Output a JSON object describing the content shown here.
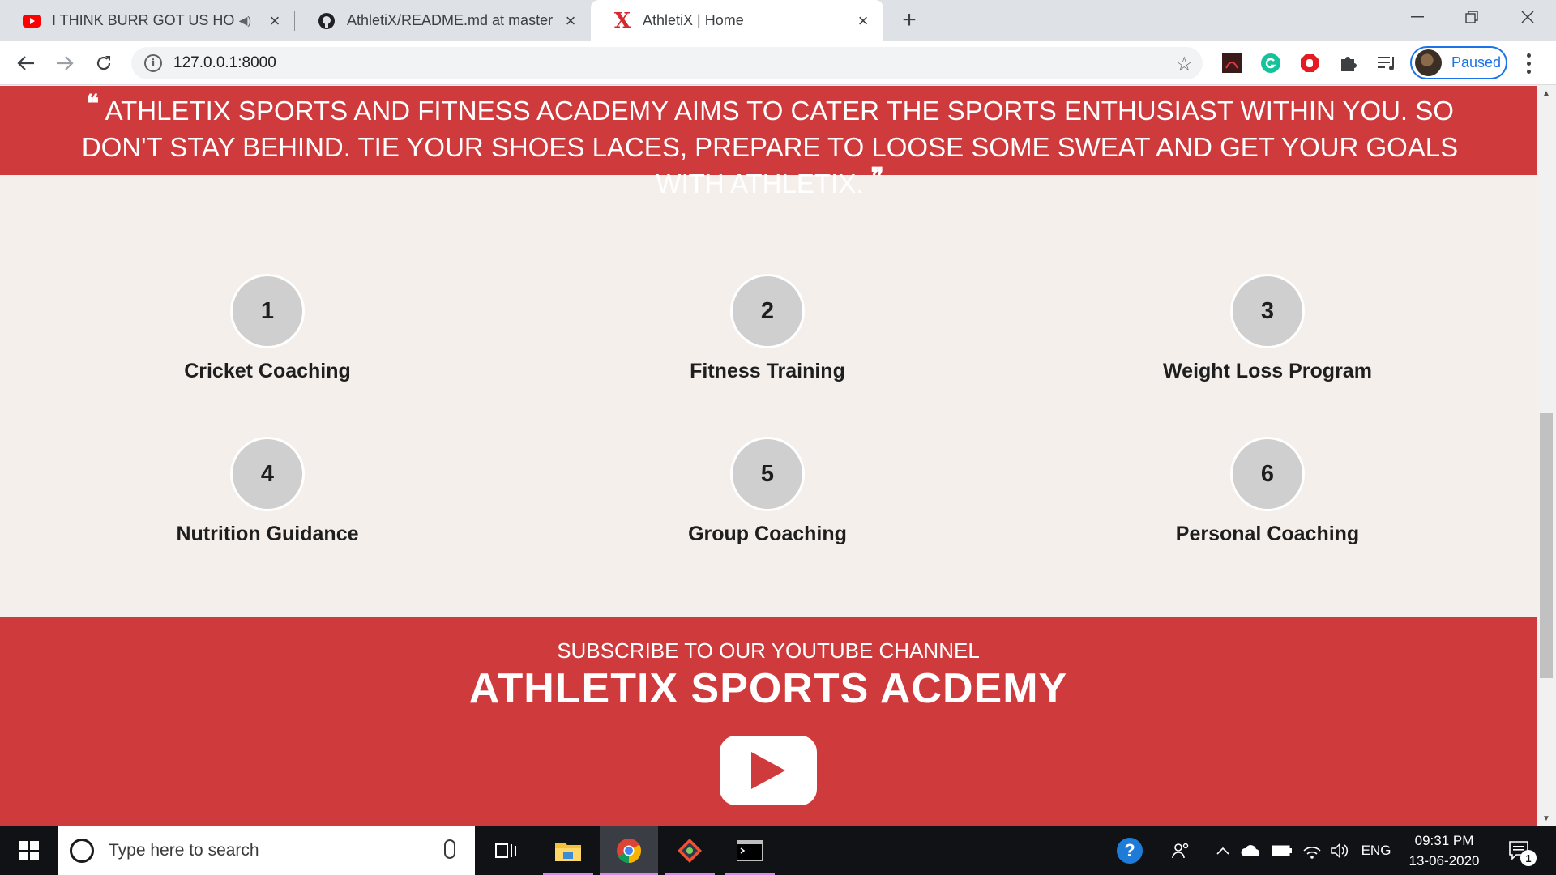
{
  "browser": {
    "tabs": [
      {
        "title": "I THINK BURR GOT US HOOK",
        "favicon": "youtube-icon",
        "audio": true,
        "active": false
      },
      {
        "title": "AthletiX/README.md at master",
        "favicon": "github-icon",
        "audio": false,
        "active": false
      },
      {
        "title": "AthletiX | Home",
        "favicon": "athletix-x-icon",
        "audio": false,
        "active": true
      }
    ],
    "new_tab_label": "+",
    "address": "127.0.0.1:8000",
    "profile_status": "Paused",
    "extensions": [
      "pdf-icon",
      "grammarly-icon",
      "adblock-icon",
      "puzzle-icon",
      "media-queue-icon"
    ]
  },
  "page": {
    "quote": "Athletix Sports and Fitness Academy aims to cater the sports enthusiast within you. So don't stay behind. Tie your shoes laces, prepare to loose some sweat and get your goals with Athletix.",
    "services": [
      {
        "number": "1",
        "label": "Cricket Coaching"
      },
      {
        "number": "2",
        "label": "Fitness Training"
      },
      {
        "number": "3",
        "label": "Weight Loss Program"
      },
      {
        "number": "4",
        "label": "Nutrition Guidance"
      },
      {
        "number": "5",
        "label": "Group Coaching"
      },
      {
        "number": "6",
        "label": "Personal Coaching"
      }
    ],
    "subscribe": {
      "title": "Subscribe to our YouTube Channel",
      "channel": "Athletix Sports Acdemy",
      "button_icon": "youtube-play-icon"
    },
    "colors": {
      "accent": "#cf3a3d",
      "background": "#f5efeb",
      "circle": "#cfcfcf"
    }
  },
  "taskbar": {
    "search_placeholder": "Type here to search",
    "language": "ENG",
    "time": "09:31 PM",
    "date": "13-06-2020",
    "notification_count": "1"
  }
}
